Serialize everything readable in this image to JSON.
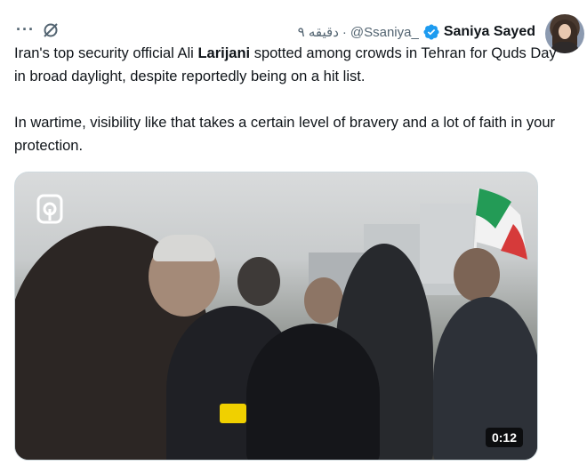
{
  "tweet": {
    "display_name": "Saniya Sayed",
    "handle": "@Ssaniya_",
    "separator": "·",
    "time": "۹ دقیقه",
    "text_part1": "Iran's top security official Ali ",
    "text_bold": "Larijani",
    "text_part2": " spotted among crowds in Tehran for Quds Day in broad daylight, despite reportedly being on a hit list.",
    "text_para2": "In wartime, visibility like that takes a certain level of bravery and a lot of faith in your protection.",
    "more_label": "···",
    "video_duration": "0:12"
  },
  "icons": {
    "verified": "verified-badge-icon",
    "grok": "grok-icon",
    "more": "more-icon",
    "logo": "channel-logo-icon"
  },
  "colors": {
    "verified_blue": "#1d9bf0",
    "secondary_text": "#536471"
  }
}
